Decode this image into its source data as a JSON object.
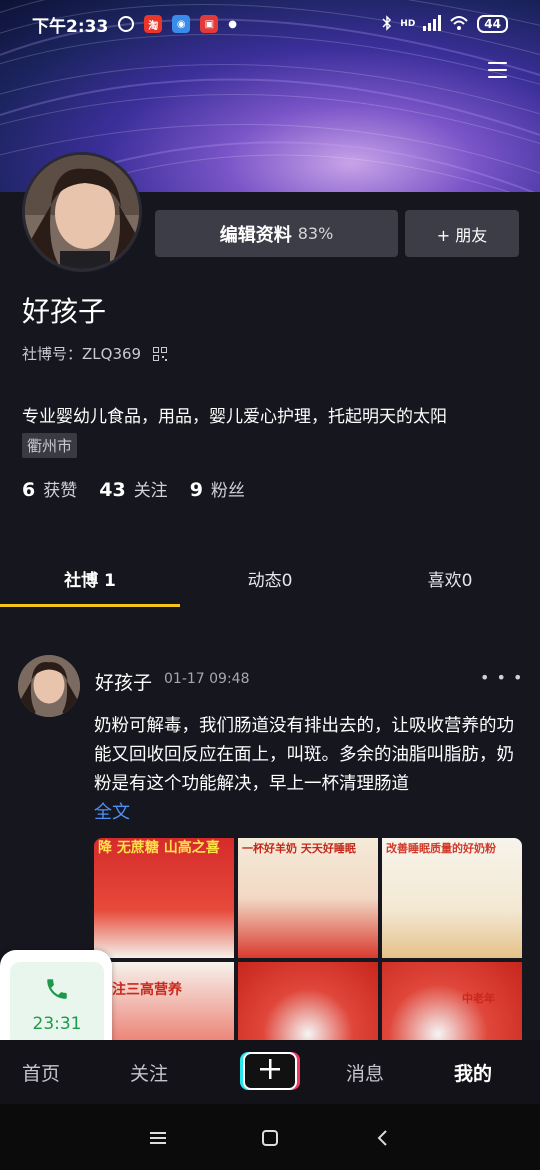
{
  "status_bar": {
    "time": "下午2:33",
    "network": "HD",
    "battery": "44"
  },
  "profile": {
    "edit_label": "编辑资料",
    "completion": "83%",
    "friend_label": "+ 朋友",
    "name": "好孩子",
    "id_label": "社博号：ZLQ369",
    "bio": "专业婴幼儿食品，用品，婴儿爱心护理，托起明天的太阳",
    "location": "衢州市"
  },
  "stats": [
    {
      "num": "6",
      "label": "获赞"
    },
    {
      "num": "43",
      "label": "关注"
    },
    {
      "num": "9",
      "label": "粉丝"
    }
  ],
  "tabs": [
    "社博 1",
    "动态0",
    "喜欢0"
  ],
  "post": {
    "author": "好孩子",
    "time": "01-17 09:48",
    "more": "• • •",
    "text": "奶粉可解毒，我们肠道没有排出去的，让吸收营养的功能又回收回反应在面上，叫斑。多余的油脂叫脂肪，奶粉是有这个功能解决，早上一杯清理肠道",
    "full_text_link": "全文",
    "images": [
      {
        "caption": "降 无蔗糖 山高之喜"
      },
      {
        "caption": "一杯好羊奶 天天好睡眠"
      },
      {
        "caption": "改善睡眠质量的好奶粉"
      },
      {
        "caption": "专注三高营养"
      },
      {
        "caption": ""
      },
      {
        "caption": "中老年"
      }
    ]
  },
  "call_widget": {
    "time": "23:31"
  },
  "bottom_nav": {
    "home": "首页",
    "follow": "关注",
    "messages": "消息",
    "me": "我的"
  },
  "colors": {
    "accent_tab": "#f5c518",
    "link": "#4d8ff2",
    "call_green": "#1d9a49"
  }
}
